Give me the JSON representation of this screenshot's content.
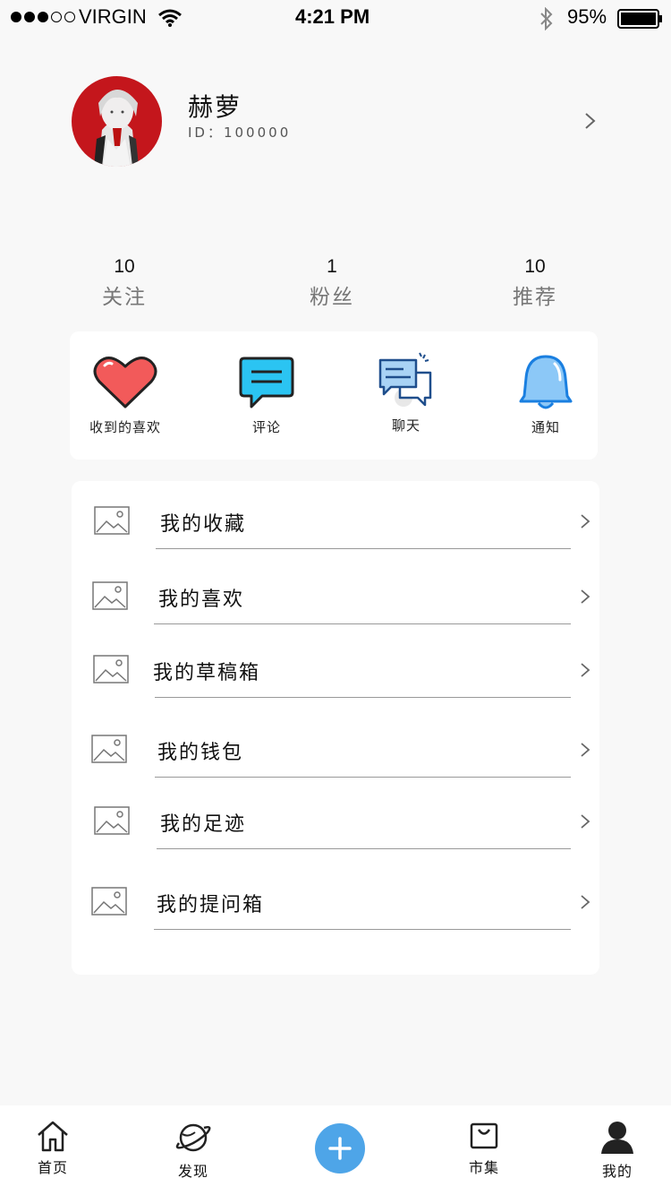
{
  "status_bar": {
    "carrier": "VIRGIN",
    "time": "4:21 PM",
    "battery": "95%",
    "battery_level": 0.95,
    "signal_strength": 3
  },
  "profile": {
    "name": "赫萝",
    "id_text": "ID：100000"
  },
  "stats": [
    {
      "count": "10",
      "label": "关注"
    },
    {
      "count": "1",
      "label": "粉丝"
    },
    {
      "count": "10",
      "label": "推荐"
    }
  ],
  "quick_actions": [
    {
      "label": "收到的喜欢",
      "icon": "heart-icon"
    },
    {
      "label": "评论",
      "icon": "comment-icon"
    },
    {
      "label": "聊天",
      "icon": "chat-icon"
    },
    {
      "label": "通知",
      "icon": "bell-icon"
    }
  ],
  "menu": [
    {
      "label": "我的收藏",
      "icon": "image-placeholder-icon"
    },
    {
      "label": "我的喜欢",
      "icon": "image-placeholder-icon"
    },
    {
      "label": "我的草稿箱",
      "icon": "image-placeholder-icon"
    },
    {
      "label": "我的钱包",
      "icon": "image-placeholder-icon"
    },
    {
      "label": "我的足迹",
      "icon": "image-placeholder-icon"
    },
    {
      "label": "我的提问箱",
      "icon": "image-placeholder-icon"
    }
  ],
  "tab_bar": {
    "tabs": [
      {
        "label": "首页",
        "icon": "home-icon"
      },
      {
        "label": "发现",
        "icon": "planet-icon"
      },
      {
        "label": "",
        "icon": "plus-icon"
      },
      {
        "label": "市集",
        "icon": "shopping-bag-icon"
      },
      {
        "label": "我的",
        "icon": "user-icon"
      }
    ],
    "active": "我的"
  },
  "colors": {
    "background": "#f8f8f8",
    "accent_blue": "#4ea5e8",
    "heart_red": "#f25a5a",
    "comment_cyan": "#2bc4f2",
    "bell_blue": "#8cc8f7"
  }
}
